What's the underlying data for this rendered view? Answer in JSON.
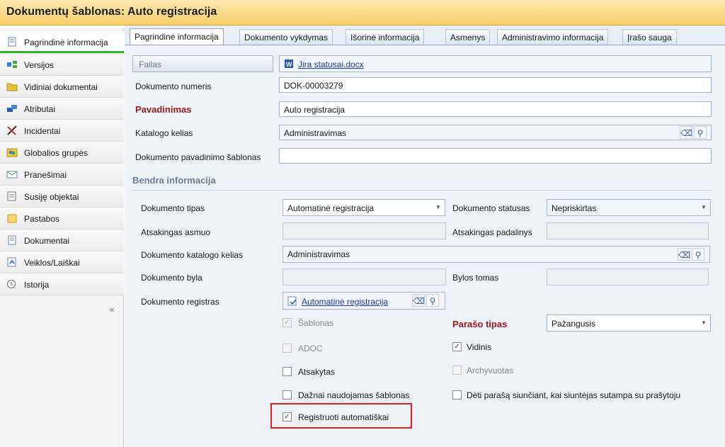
{
  "title": "Dokumentų šablonas: Auto registracija",
  "sidebar": {
    "items": [
      {
        "label": "Pagrindinė informacija",
        "icon": "document-icon"
      },
      {
        "label": "Versijos",
        "icon": "versions-icon"
      },
      {
        "label": "Vidiniai dokumentai",
        "icon": "folder-icon"
      },
      {
        "label": "Atributai",
        "icon": "attributes-icon"
      },
      {
        "label": "Incidentai",
        "icon": "tools-icon"
      },
      {
        "label": "Globalios grupės",
        "icon": "group-icon"
      },
      {
        "label": "Pranešimai",
        "icon": "message-icon"
      },
      {
        "label": "Susiję objektai",
        "icon": "related-icon"
      },
      {
        "label": "Pastabos",
        "icon": "note-icon"
      },
      {
        "label": "Dokumentai",
        "icon": "document-icon"
      },
      {
        "label": "Veiklos/Laiškai",
        "icon": "activity-icon"
      },
      {
        "label": "Istorija",
        "icon": "history-icon"
      }
    ],
    "collapse": "«"
  },
  "tabs": [
    "Pagrindinė informacija",
    "Dokumento vykdymas",
    "Išorinė informacija",
    "Asmenys",
    "Administravimo informacija",
    "Įrašo sauga"
  ],
  "form": {
    "file_button": "Failas",
    "file_link": "Jira statusai.docx",
    "doc_number_label": "Dokumento numeris",
    "doc_number_value": "DOK-00003279",
    "name_label": "Pavadinimas",
    "name_value": "Auto registracija",
    "catalog_label": "Katalogo kelias",
    "catalog_value": "Administravimas",
    "template_name_label": "Dokumento pavadinimo šablonas",
    "template_name_value": ""
  },
  "general": {
    "section_title": "Bendra informacija",
    "doc_type_label": "Dokumento tipas",
    "doc_type_value": "Automatinė registracija",
    "doc_status_label": "Dokumento statusas",
    "doc_status_value": "Nepriskirtas",
    "responsible_label": "Atsakingas asmuo",
    "responsible_unit_label": "Atsakingas padalinys",
    "doc_catalog_label": "Dokumento katalogo kelias",
    "doc_catalog_value": "Administravimas",
    "doc_file_label": "Dokumento byla",
    "file_volume_label": "Bylos tomas",
    "registry_label": "Dokumento registras",
    "registry_value": "Automatinė registracija",
    "signature_type_label": "Parašo tipas",
    "signature_type_value": "Pažangusis"
  },
  "checkboxes": {
    "template": {
      "label": "Šablonas",
      "checked": true,
      "disabled": true
    },
    "adoc": {
      "label": "ADOC",
      "checked": false,
      "disabled": true
    },
    "internal": {
      "label": "Vidinis",
      "checked": true,
      "disabled": false
    },
    "answered": {
      "label": "Atsakytas",
      "checked": false,
      "disabled": false
    },
    "archived": {
      "label": "Archyvuotas",
      "checked": false,
      "disabled": true
    },
    "frequent": {
      "label": "Dažnai naudojamas šablonas",
      "checked": false,
      "disabled": false
    },
    "sign_on_send": {
      "label": "Dėti parašą siunčiant, kai siuntėjas sutampa su prašytoju",
      "checked": false,
      "disabled": false
    },
    "auto_register": {
      "label": "Registruoti automatiškai",
      "checked": true,
      "disabled": false
    }
  },
  "colors": {
    "title_bar": "#f7cf6a",
    "active_nav_underline": "#2eb82e",
    "required_label": "#a01818",
    "highlight_box": "#e02020",
    "link": "#1a3ca8"
  }
}
